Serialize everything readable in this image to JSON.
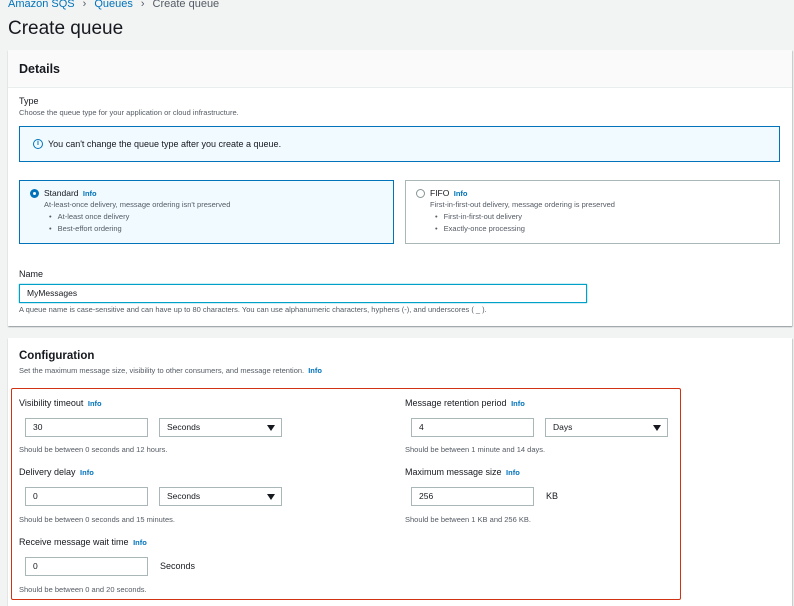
{
  "breadcrumb": [
    "Amazon SQS",
    "Queues",
    "Create queue"
  ],
  "page_title": "Create queue",
  "details": {
    "title": "Details",
    "type_label": "Type",
    "type_desc": "Choose the queue type for your application or cloud infrastructure.",
    "alert": "You can't change the queue type after you create a queue.",
    "standard": {
      "title": "Standard",
      "info": "Info",
      "desc": "At-least-once delivery, message ordering isn't preserved",
      "bullets": [
        "At-least once delivery",
        "Best-effort ordering"
      ],
      "selected": true
    },
    "fifo": {
      "title": "FIFO",
      "info": "Info",
      "desc": "First-in-first-out delivery, message ordering is preserved",
      "bullets": [
        "First-in-first-out delivery",
        "Exactly-once processing"
      ],
      "selected": false
    },
    "name_label": "Name",
    "name_value": "MyMessages",
    "name_hint": "A queue name is case-sensitive and can have up to 80 characters. You can use alphanumeric characters, hyphens (-), and underscores ( _ )."
  },
  "configuration": {
    "title": "Configuration",
    "desc": "Set the maximum message size, visibility to other consumers, and message retention.",
    "info": "Info",
    "visibility_timeout": {
      "label": "Visibility timeout",
      "info": "Info",
      "value": "30",
      "unit": "Seconds",
      "hint": "Should be between 0 seconds and 12 hours."
    },
    "retention": {
      "label": "Message retention period",
      "info": "Info",
      "value": "4",
      "unit": "Days",
      "hint": "Should be between 1 minute and 14 days."
    },
    "delivery_delay": {
      "label": "Delivery delay",
      "info": "Info",
      "value": "0",
      "unit": "Seconds",
      "hint": "Should be between 0 seconds and 15 minutes."
    },
    "max_size": {
      "label": "Maximum message size",
      "info": "Info",
      "value": "256",
      "unit": "KB",
      "hint": "Should be between 1 KB and 256 KB."
    },
    "wait_time": {
      "label": "Receive message wait time",
      "info": "Info",
      "value": "0",
      "unit": "Seconds",
      "hint": "Should be between 0 and 20 seconds."
    }
  },
  "colors": {
    "link": "#0073bb",
    "highlight": "#d13212",
    "focus": "#00a1c9"
  }
}
